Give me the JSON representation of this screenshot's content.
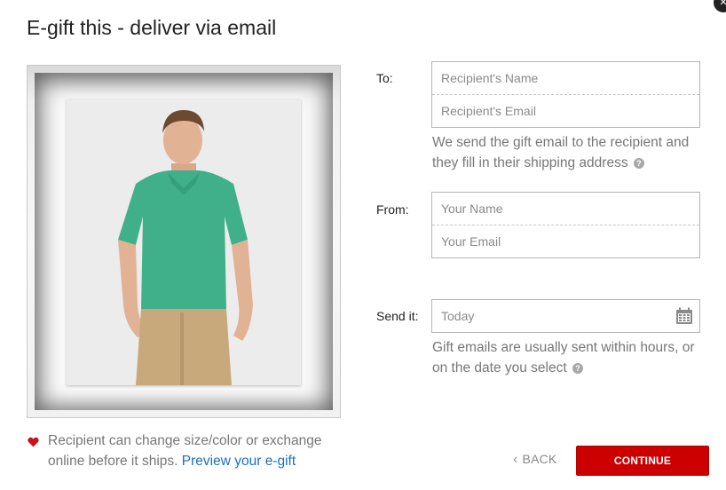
{
  "dialog": {
    "title": "E-gift this - deliver via email",
    "close_label": "✕"
  },
  "form": {
    "to": {
      "label": "To:",
      "name_placeholder": "Recipient's Name",
      "email_placeholder": "Recipient's Email"
    },
    "to_hint": "We send the gift email to the recipient and they fill in their shipping address",
    "from": {
      "label": "From:",
      "name_placeholder": "Your Name",
      "email_placeholder": "Your Email"
    },
    "send": {
      "label": "Send it:",
      "date_placeholder": "Today"
    },
    "send_hint": "Gift emails are usually sent within hours, or on the date you select",
    "help_glyph": "?"
  },
  "notice": {
    "text": "Recipient can change size/color or exchange online before it ships.",
    "link": "Preview your e-gift"
  },
  "actions": {
    "back_chevron": "‹",
    "back_label": "BACK",
    "continue_label": "CONTINUE"
  },
  "colors": {
    "primary": "#cc0000",
    "link": "#1b70c4",
    "hint_text": "#777777"
  },
  "icons": [
    "close-icon",
    "help-icon",
    "calendar-icon",
    "heart-icon",
    "chevron-left-icon"
  ]
}
